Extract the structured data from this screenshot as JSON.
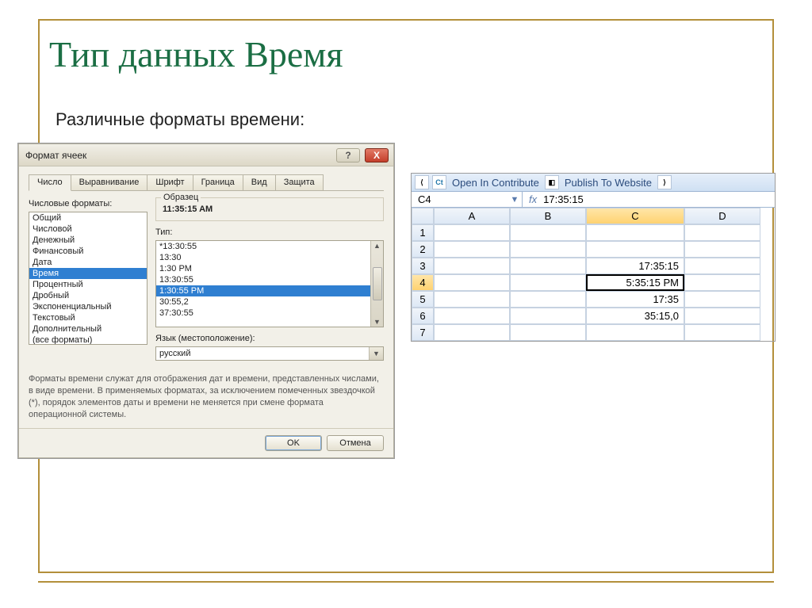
{
  "slide": {
    "title": "Тип данных Время",
    "subtitle": "Различные форматы времени:"
  },
  "dialog": {
    "title": "Формат ячеек",
    "help": "?",
    "close": "X",
    "tabs": [
      "Число",
      "Выравнивание",
      "Шрифт",
      "Граница",
      "Вид",
      "Защита"
    ],
    "formats_label": "Числовые форматы:",
    "formats": [
      "Общий",
      "Числовой",
      "Денежный",
      "Финансовый",
      "Дата",
      "Время",
      "Процентный",
      "Дробный",
      "Экспоненциальный",
      "Текстовый",
      "Дополнительный",
      "(все форматы)"
    ],
    "formats_selected_index": 5,
    "sample_label": "Образец",
    "sample_value": "11:35:15 AM",
    "type_label": "Тип:",
    "types": [
      "*13:30:55",
      "13:30",
      "1:30 PM",
      "13:30:55",
      "1:30:55 PM",
      "30:55,2",
      "37:30:55"
    ],
    "types_selected_index": 4,
    "lang_label": "Язык (местоположение):",
    "lang_value": "русский",
    "description": "Форматы времени служат для отображения дат и времени, представленных числами, в виде времени. В применяемых форматах, за исключением помеченных звездочкой (*), порядок элементов даты и времени не меняется при смене формата операционной системы.",
    "ok": "OK",
    "cancel": "Отмена"
  },
  "sheet": {
    "toolbar": {
      "contribute": "Open In Contribute",
      "publish": "Publish To Website",
      "ct": "Ct"
    },
    "namebox": "C4",
    "fx": "fx",
    "formula": "17:35:15",
    "columns": [
      "A",
      "B",
      "C",
      "D"
    ],
    "active_col_index": 2,
    "rows": [
      {
        "n": "1",
        "cells": [
          "",
          "",
          "",
          ""
        ]
      },
      {
        "n": "2",
        "cells": [
          "",
          "",
          "",
          ""
        ]
      },
      {
        "n": "3",
        "cells": [
          "",
          "",
          "17:35:15",
          ""
        ]
      },
      {
        "n": "4",
        "cells": [
          "",
          "",
          "5:35:15 PM",
          ""
        ],
        "active_col": 2
      },
      {
        "n": "5",
        "cells": [
          "",
          "",
          "17:35",
          ""
        ]
      },
      {
        "n": "6",
        "cells": [
          "",
          "",
          "35:15,0",
          ""
        ]
      },
      {
        "n": "7",
        "cells": [
          "",
          "",
          "",
          ""
        ]
      }
    ],
    "active_row_index": 3
  }
}
